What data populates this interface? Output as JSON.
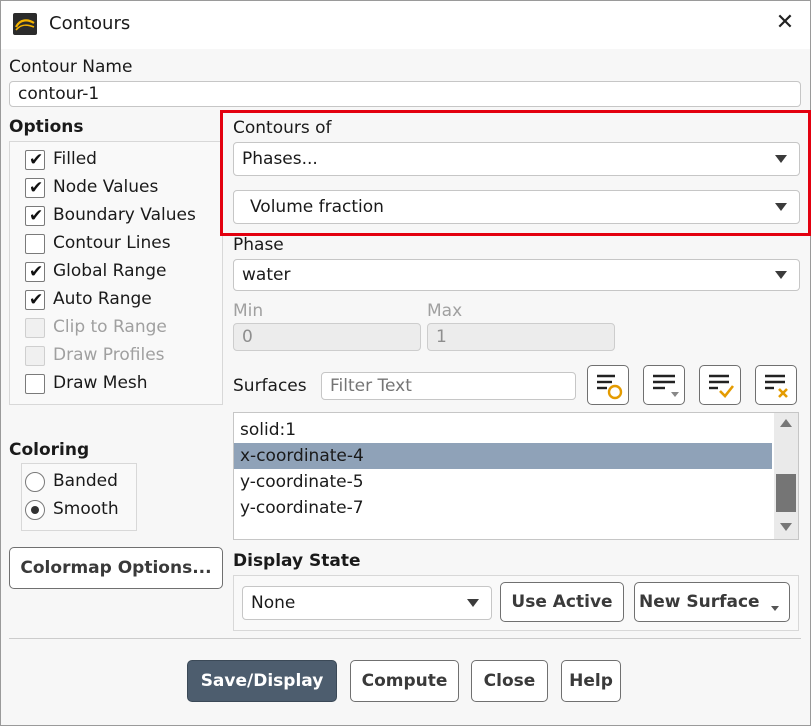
{
  "window": {
    "title": "Contours",
    "close_glyph": "✕",
    "app_icon": "fluent-app-icon"
  },
  "contour_name": {
    "label": "Contour Name",
    "value": "contour-1"
  },
  "options": {
    "label": "Options",
    "items": [
      {
        "label": "Filled",
        "checked": true,
        "enabled": true
      },
      {
        "label": "Node Values",
        "checked": true,
        "enabled": true
      },
      {
        "label": "Boundary Values",
        "checked": true,
        "enabled": true
      },
      {
        "label": "Contour Lines",
        "checked": false,
        "enabled": true
      },
      {
        "label": "Global Range",
        "checked": true,
        "enabled": true
      },
      {
        "label": "Auto Range",
        "checked": true,
        "enabled": true
      },
      {
        "label": "Clip to Range",
        "checked": false,
        "enabled": false
      },
      {
        "label": "Draw Profiles",
        "checked": false,
        "enabled": false
      },
      {
        "label": "Draw Mesh",
        "checked": false,
        "enabled": true
      }
    ]
  },
  "coloring": {
    "label": "Coloring",
    "items": [
      {
        "label": "Banded",
        "selected": false
      },
      {
        "label": "Smooth",
        "selected": true
      }
    ]
  },
  "colormap_button": "Colormap Options...",
  "contours_of": {
    "label": "Contours of",
    "category": "Phases...",
    "quantity": "Volume fraction"
  },
  "phase": {
    "label": "Phase",
    "value": "water"
  },
  "range": {
    "min_label": "Min",
    "min_value": "0",
    "max_label": "Max",
    "max_value": "1"
  },
  "surfaces": {
    "label": "Surfaces",
    "filter_placeholder": "Filter Text",
    "icons": [
      "filter-new-icon",
      "list-options-icon",
      "select-all-icon",
      "deselect-all-icon"
    ],
    "items": [
      {
        "label": "solid:1",
        "selected": false
      },
      {
        "label": "x-coordinate-4",
        "selected": true
      },
      {
        "label": "y-coordinate-5",
        "selected": false
      },
      {
        "label": "y-coordinate-7",
        "selected": false
      }
    ]
  },
  "display_state": {
    "label": "Display State",
    "value": "None",
    "use_active": "Use Active",
    "new_surface": "New Surface"
  },
  "footer": {
    "save_display": "Save/Display",
    "compute": "Compute",
    "close": "Close",
    "help": "Help"
  },
  "colors": {
    "highlight_box": "#e3000f",
    "primary_button": "#4d5d6e",
    "selection": "#8fa2b8"
  }
}
